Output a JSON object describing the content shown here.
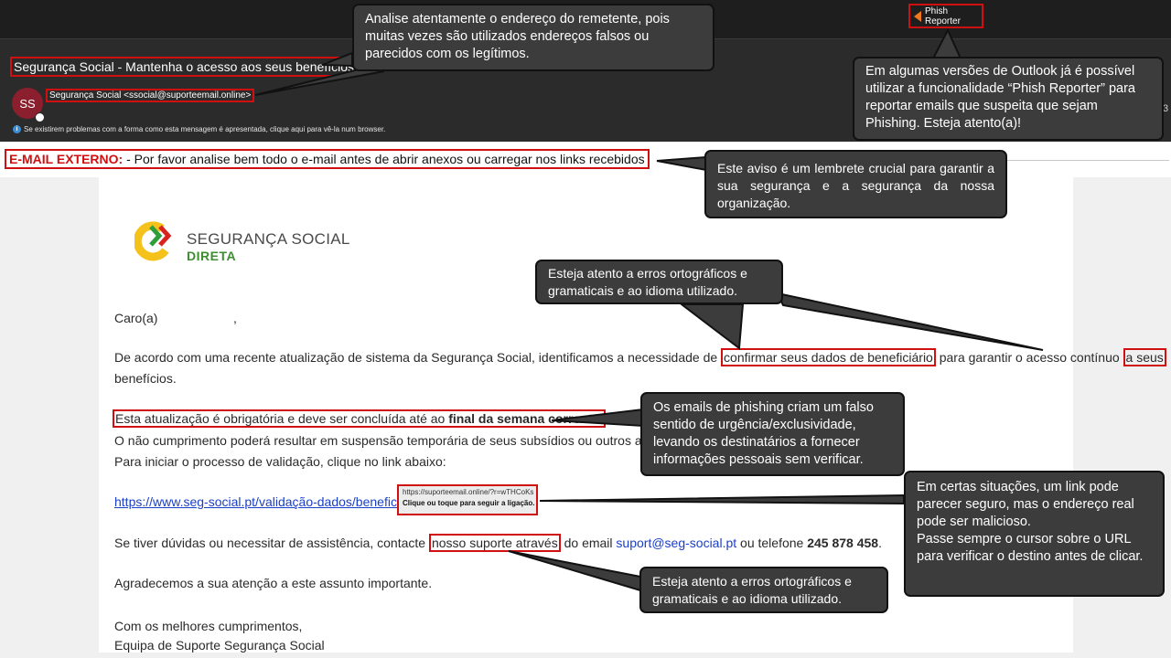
{
  "toolbar": {
    "phish_reporter_label": "Phish Reporter"
  },
  "header": {
    "subject": "Segurança Social - Mantenha o acesso aos seus benefícios",
    "avatar_initials": "SS",
    "sender": "Segurança Social <ssocial@suporteemail.online>",
    "info_message": "Se existirem problemas com a forma como esta mensagem é apresentada, clique aqui para vê-la num browser.",
    "right_edge_number": "3"
  },
  "external_warning": {
    "label": "E-MAIL EXTERNO:",
    "text": " - Por favor analise bem todo o e-mail antes de abrir anexos ou carregar nos links recebidos"
  },
  "logo": {
    "line1": "SEGURANÇA SOCIAL",
    "line2": "DIRETA"
  },
  "body": {
    "greeting": "Caro(a)",
    "greeting_comma": ",",
    "p1_start": "De acordo com uma recente atualização de sistema da Segurança Social, identificamos a necessidade de ",
    "p1_highlight": "confirmar seus dados de beneficiário",
    "p1_mid": " para garantir o acesso contínuo ",
    "p1_highlight2": "a seus",
    "p1_end": "benefícios.",
    "p2_highlight_start": "Esta atualização é obrigatória e deve ser concluída até ao ",
    "p2_highlight_bold": "final da semana corrente",
    "p2_highlight_end": ".",
    "p3": "O não cumprimento poderá resultar em suspensão temporária de seus subsídios ou outros apoios.",
    "p4": "Para iniciar o processo de validação, clique no link abaixo:",
    "link_text": "https://www.seg-social.pt/validação-dados/beneficiario/",
    "tooltip_url": "https://suporteemail.online/?r=wTHCoKs",
    "tooltip_hint": "Clique ou toque para seguir a ligação.",
    "p5_start": "Se tiver dúvidas ou necessitar de assistência, contacte ",
    "p5_highlight": "nosso suporte através",
    "p5_mid": " do email ",
    "p5_email": "suport@seg-social.pt",
    "p5_mid2": " ou telefone ",
    "p5_phone": "245 878 458",
    "p5_end": ".",
    "p6": "Agradecemos a sua atenção a este assunto importante.",
    "closing": "Com os melhores cumprimentos,",
    "signature": "Equipa de Suporte Segurança Social"
  },
  "callouts": {
    "sender_address": "Analise atentamente o endereço do remetente, pois muitas vezes são utilizados endereços falsos ou parecidos com os legítimos.",
    "phish_reporter": "Em algumas versões de Outlook já é possível utilizar a funcionalidade “Phish Reporter” para reportar emails que suspeita que sejam Phishing. Esteja atento(a)!",
    "external_notice": "Este aviso é um lembrete crucial para garantir a sua segurança e a segurança da nossa organização.",
    "spelling_top": "Esteja atento a erros ortográficos e gramaticais e ao idioma utilizado.",
    "urgency": "Os emails de phishing criam um falso sentido de urgência/exclusividade, levando os destinatários a fornecer informações pessoais sem verificar.",
    "link_check": "Em certas situações, um link pode parecer seguro, mas o endereço real pode ser malicioso.\nPasse sempre o cursor sobre o URL para verificar o destino antes de clicar.",
    "spelling_bottom": "Esteja atento a erros ortográficos e gramaticais e ao idioma utilizado."
  },
  "colors": {
    "highlight_red": "#d01010",
    "callout_bg": "#3c3c3c",
    "link_blue": "#1a3fc8",
    "logo_green": "#3d8e2f",
    "logo_yellow": "#f4c21b"
  }
}
